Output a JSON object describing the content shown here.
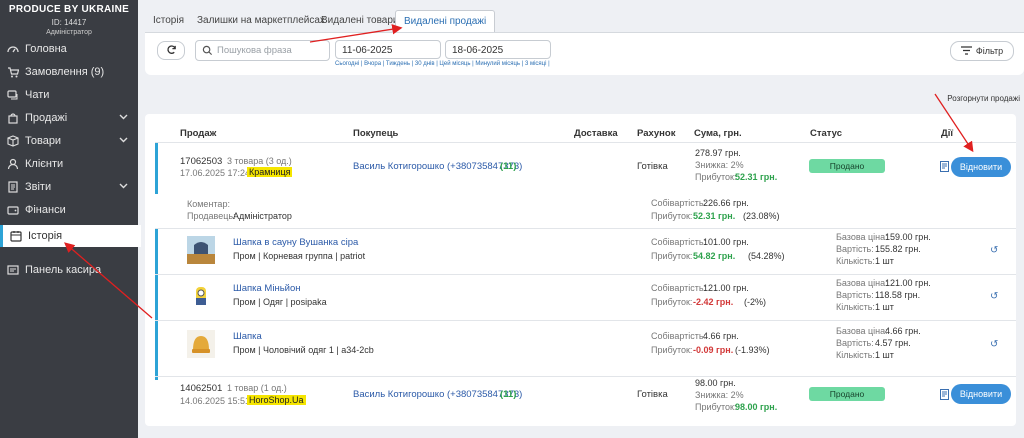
{
  "brand": {
    "name": "PRODUCE BY UKRAINE",
    "id": "ID: 14417",
    "role": "Адміністратор"
  },
  "sidebar": [
    {
      "label": "Головна",
      "icon": "dashboard-icon"
    },
    {
      "label": "Замовлення (9)",
      "icon": "cart-icon"
    },
    {
      "label": "Чати",
      "icon": "chat-icon"
    },
    {
      "label": "Продажі",
      "icon": "bag-icon",
      "chevron": true
    },
    {
      "label": "Товари",
      "icon": "box-icon",
      "chevron": true
    },
    {
      "label": "Клієнти",
      "icon": "user-icon"
    },
    {
      "label": "Звіти",
      "icon": "report-icon",
      "chevron": true
    },
    {
      "label": "Фінанси",
      "icon": "wallet-icon"
    },
    {
      "label": "Історія",
      "icon": "history-icon",
      "active": true
    },
    {
      "label": "Панель касира",
      "icon": "cashier-icon"
    }
  ],
  "tabs": [
    "Історія",
    "Залишки на маркетплейсах",
    "Видалені товари",
    "Видалені продажі"
  ],
  "filters": {
    "search_placeholder": "Пошукова фраза",
    "date_from": "11-06-2025",
    "date_to": "18-06-2025",
    "quick_ranges": "Сьогодні | Вчора | Тиждень | 30 днів | Цей місяць | Минулий місяць | 3 місяці |",
    "filter_label": "Фільтр",
    "expand_label": "Розгорнути продажі"
  },
  "table": {
    "headers": [
      "Продаж",
      "Покупець",
      "Доставка",
      "Рахунок",
      "Сума, грн.",
      "Статус",
      "Дії"
    ]
  },
  "sales": [
    {
      "id": "17062503",
      "qty": "3 товара (3 од.)",
      "date": "17.06.2025 17:24",
      "channel": "Крамниця",
      "buyer": "Василь Котигорошко (+380735847373)",
      "buyer_count": "(11)",
      "account": "Готівка",
      "sum": "278.97 грн.",
      "discount": "Знижка: 2%",
      "profit_label": "Прибуток:",
      "profit": "52.31 грн.",
      "status": "Продано",
      "restore": "Відновити",
      "detail": {
        "comment_label": "Коментар:",
        "seller_label": "Продавець:",
        "seller": "Адміністратор",
        "cost_label": "Собівартість:",
        "cost": "226.66 грн.",
        "profit_label": "Прибуток:",
        "profit": "52.31 грн.",
        "profit_pct": "(23.08%)"
      }
    },
    {
      "id": "14062501",
      "qty": "1 товар (1 од.)",
      "date": "14.06.2025 15:51",
      "channel": "HoroShop.Ua",
      "buyer": "Василь Котигорошко (+380735847373)",
      "buyer_count": "(11)",
      "account": "Готівка",
      "sum": "98.00 грн.",
      "discount": "Знижка: 2%",
      "profit_label": "Прибуток:",
      "profit": "98.00 грн.",
      "status": "Продано",
      "restore": "Відновити"
    }
  ],
  "items": [
    {
      "name": "Шапка в сауну Вушанка сіра",
      "path": "Пром | Корневая группа | patriot",
      "cost": "101.00 грн.",
      "profit": "54.82 грн.",
      "pct": "(54.28%)",
      "profit_neg": false,
      "base": "159.00 грн.",
      "price": "155.82 грн.",
      "qty": "1 шт"
    },
    {
      "name": "Шапка Міньйон",
      "path": "Пром | Одяг | posipaka",
      "cost": "121.00 грн.",
      "profit": "-2.42 грн.",
      "pct": "(-2%)",
      "profit_neg": true,
      "base": "121.00 грн.",
      "price": "118.58 грн.",
      "qty": "1 шт"
    },
    {
      "name": "Шапка",
      "path": "Пром | Чоловічий одяг 1 | a34-2cb",
      "cost": "4.66 грн.",
      "profit": "-0.09 грн.",
      "pct": "(-1.93%)",
      "profit_neg": true,
      "base": "4.66 грн.",
      "price": "4.57 грн.",
      "qty": "1 шт"
    }
  ],
  "labels": {
    "cost": "Собівартість:",
    "profit": "Прибуток:",
    "base": "Базова ціна:",
    "price": "Вартість:",
    "qty": "Кількість:"
  },
  "colors": {
    "accent": "#2da3d6",
    "button": "#3a8fd9",
    "sold": "#6ed9a2",
    "channel_tag": "#f5e500",
    "annotation": "#e02020"
  }
}
